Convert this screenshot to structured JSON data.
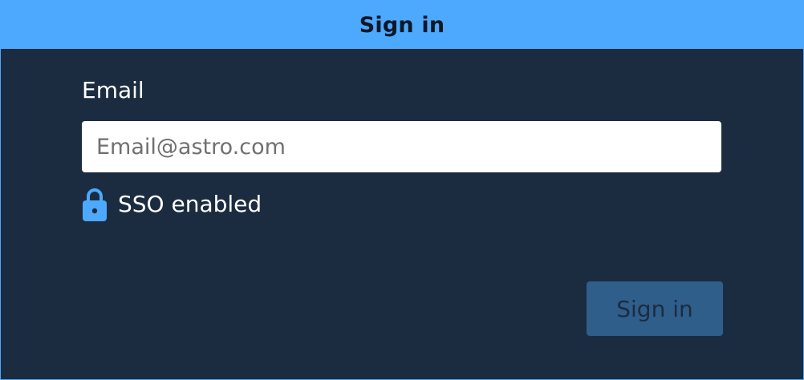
{
  "dialog": {
    "title": "Sign in"
  },
  "form": {
    "email_label": "Email",
    "email_value": "",
    "email_placeholder": "Email@astro.com",
    "sso_icon": "lock-icon",
    "sso_text": "SSO enabled",
    "submit_label": "Sign in"
  },
  "colors": {
    "accent": "#4ca9fe",
    "background": "#1c2c40",
    "button_disabled": "#2f5e8b",
    "input_bg": "#ffffff"
  }
}
